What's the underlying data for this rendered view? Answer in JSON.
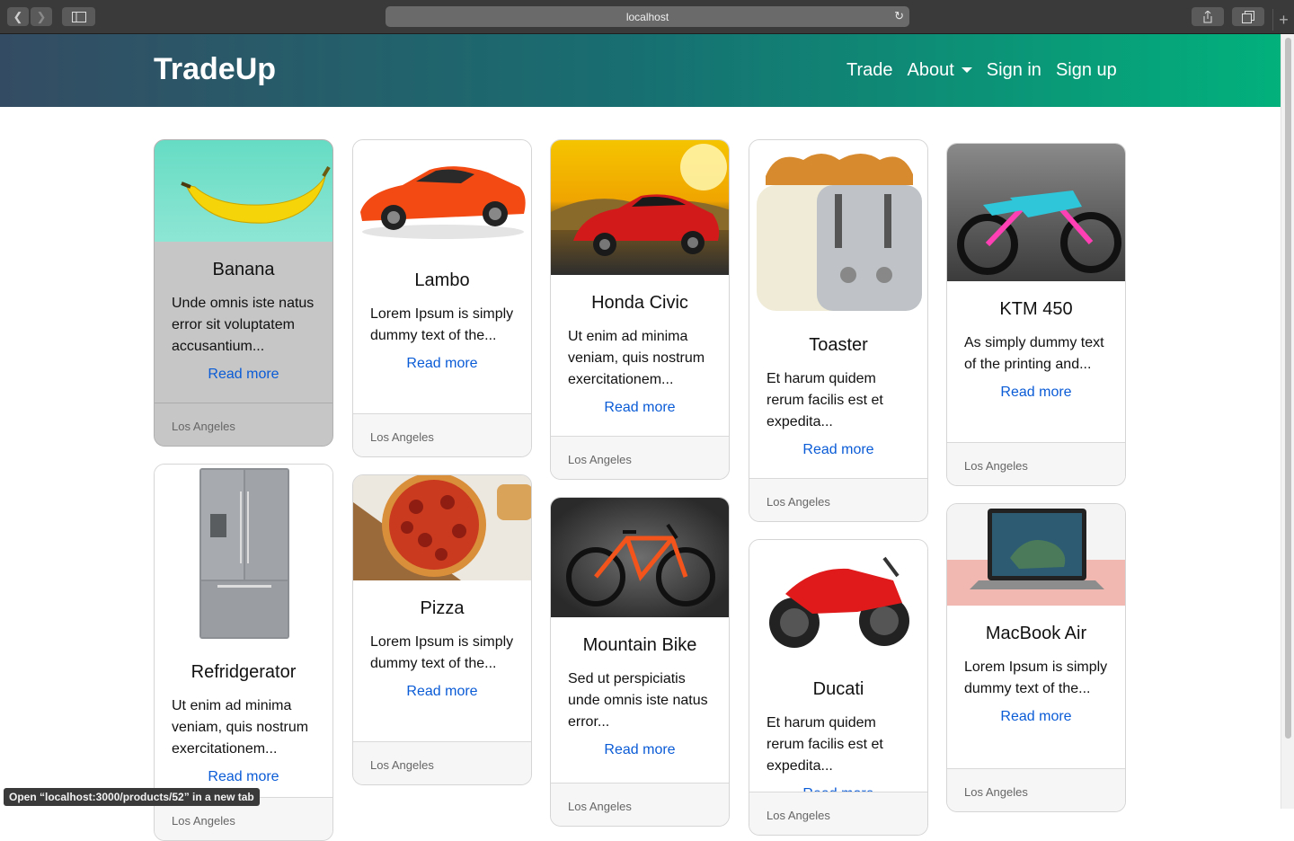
{
  "browser": {
    "url": "localhost",
    "status_text": "Open “localhost:3000/products/52” in a new tab"
  },
  "navbar": {
    "brand": "TradeUp",
    "links": [
      "Trade",
      "About",
      "Sign in",
      "Sign up"
    ]
  },
  "cards": [
    {
      "title": "Banana",
      "text": "Unde omnis iste natus error sit voluptatem accusantium...",
      "read_more": "Read more",
      "location": "Los Angeles"
    },
    {
      "title": "Lambo",
      "text": "Lorem Ipsum is simply dummy text of the...",
      "read_more": "Read more",
      "location": "Los Angeles"
    },
    {
      "title": "Honda Civic",
      "text": "Ut enim ad minima veniam, quis nostrum exercitationem...",
      "read_more": "Read more",
      "location": "Los Angeles"
    },
    {
      "title": "Toaster",
      "text": "Et harum quidem rerum facilis est et expedita...",
      "read_more": "Read more",
      "location": "Los Angeles"
    },
    {
      "title": "KTM 450",
      "text": "As simply dummy text of the printing and...",
      "read_more": "Read more",
      "location": "Los Angeles"
    },
    {
      "title": "Refridgerator",
      "text": "Ut enim ad minima veniam, quis nostrum exercitationem...",
      "read_more": "Read more",
      "location": "Los Angeles"
    },
    {
      "title": "Pizza",
      "text": "Lorem Ipsum is simply dummy text of the...",
      "read_more": "Read more",
      "location": "Los Angeles"
    },
    {
      "title": "Mountain Bike",
      "text": "Sed ut perspiciatis unde omnis iste natus error...",
      "read_more": "Read more",
      "location": "Los Angeles"
    },
    {
      "title": "Ducati",
      "text": "Et harum quidem rerum facilis est et expedita...",
      "read_more": "Read more",
      "location": "Los Angeles"
    },
    {
      "title": "MacBook Air",
      "text": "Lorem Ipsum is simply dummy text of the...",
      "read_more": "Read more",
      "location": "Los Angeles"
    }
  ],
  "colors": {
    "accent": "#0a5bd6",
    "nav_start": "#344c63",
    "nav_end": "#02b17c"
  }
}
